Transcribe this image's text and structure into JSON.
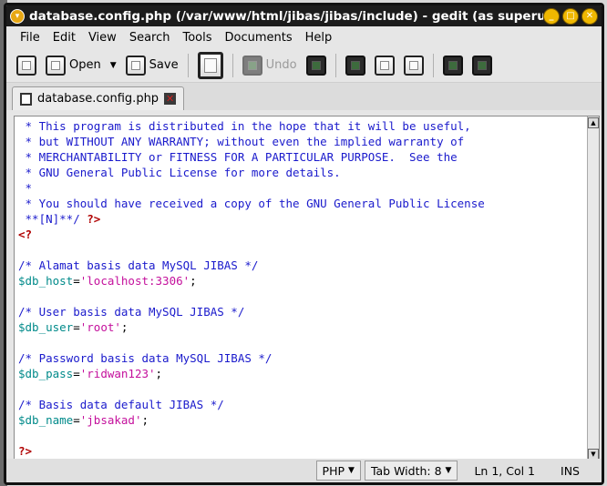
{
  "window": {
    "title": "database.config.php (/var/www/html/jibas/jibas/include) - gedit (as superuser)"
  },
  "menu": [
    "File",
    "Edit",
    "View",
    "Search",
    "Tools",
    "Documents",
    "Help"
  ],
  "toolbar": {
    "open_label": "Open",
    "save_label": "Save",
    "undo_label": "Undo"
  },
  "tab": {
    "label": "database.config.php"
  },
  "editor": {
    "lines": [
      [
        {
          "t": " * This program is distributed in the hope that it will be useful,",
          "c": "comment"
        }
      ],
      [
        {
          "t": " * but WITHOUT ANY WARRANTY; without even the implied warranty of",
          "c": "comment"
        }
      ],
      [
        {
          "t": " * MERCHANTABILITY or FITNESS FOR A PARTICULAR PURPOSE.  See the",
          "c": "comment"
        }
      ],
      [
        {
          "t": " * GNU General Public License for more details.",
          "c": "comment"
        }
      ],
      [
        {
          "t": " *",
          "c": "comment"
        }
      ],
      [
        {
          "t": " * You should have received a copy of the GNU General Public License",
          "c": "comment"
        }
      ],
      [
        {
          "t": " **[N]**/ ",
          "c": "comment"
        },
        {
          "t": "?>",
          "c": "tag"
        }
      ],
      [
        {
          "t": "<?",
          "c": "tag"
        }
      ],
      [
        {
          "t": "",
          "c": "plain"
        }
      ],
      [
        {
          "t": "/* Alamat basis data MySQL JIBAS */",
          "c": "comment"
        }
      ],
      [
        {
          "t": "$db_host",
          "c": "var"
        },
        {
          "t": "=",
          "c": "eq"
        },
        {
          "t": "'localhost:3306'",
          "c": "str"
        },
        {
          "t": ";",
          "c": "eq"
        }
      ],
      [
        {
          "t": "",
          "c": "plain"
        }
      ],
      [
        {
          "t": "/* User basis data MySQL JIBAS */",
          "c": "comment"
        }
      ],
      [
        {
          "t": "$db_user",
          "c": "var"
        },
        {
          "t": "=",
          "c": "eq"
        },
        {
          "t": "'root'",
          "c": "str"
        },
        {
          "t": ";",
          "c": "eq"
        }
      ],
      [
        {
          "t": "",
          "c": "plain"
        }
      ],
      [
        {
          "t": "/* Password basis data MySQL JIBAS */",
          "c": "comment"
        }
      ],
      [
        {
          "t": "$db_pass",
          "c": "var"
        },
        {
          "t": "=",
          "c": "eq"
        },
        {
          "t": "'ridwan123'",
          "c": "str"
        },
        {
          "t": ";",
          "c": "eq"
        }
      ],
      [
        {
          "t": "",
          "c": "plain"
        }
      ],
      [
        {
          "t": "/* Basis data default JIBAS */",
          "c": "comment"
        }
      ],
      [
        {
          "t": "$db_name",
          "c": "var"
        },
        {
          "t": "=",
          "c": "eq"
        },
        {
          "t": "'jbsakad'",
          "c": "str"
        },
        {
          "t": ";",
          "c": "eq"
        }
      ],
      [
        {
          "t": "",
          "c": "plain"
        }
      ],
      [
        {
          "t": "?>",
          "c": "tag"
        }
      ]
    ]
  },
  "status": {
    "language": "PHP",
    "tab_width": "Tab Width:  8",
    "position": "Ln 1, Col 1",
    "mode": "INS"
  }
}
